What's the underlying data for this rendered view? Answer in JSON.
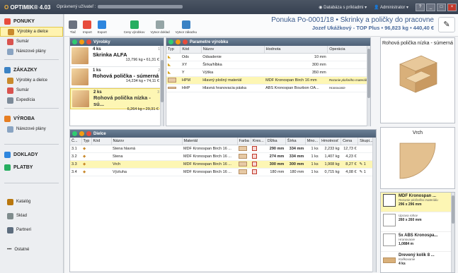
{
  "app": {
    "logo_prefix": "O",
    "logo_name": "OPTIMIK® 4.03",
    "user_label": "Oprávnený užívateľ :",
    "db_label": "Databáza s príkladmi",
    "admin_label": "Administrator",
    "help_label": "?"
  },
  "sidebar": {
    "sections": [
      {
        "title": "PONUKY",
        "items": [
          "Výrobky a dielce",
          "Sumár",
          "Nárezové plány"
        ]
      },
      {
        "title": "ZÁKAZKY",
        "items": [
          "Výrobky a dielce",
          "Sumár",
          "Expedícia"
        ]
      },
      {
        "title": "VÝROBA",
        "items": [
          "Nárezové plány"
        ]
      },
      {
        "title": "DOKLADY",
        "items": []
      },
      {
        "title": "PLATBY",
        "items": []
      }
    ],
    "bottom": [
      "Katalóg",
      "Sklad",
      "Partneri",
      "Ostatné"
    ]
  },
  "toolbar": {
    "buttons": [
      "Tlač",
      "Import",
      "Export",
      "Ceny výrobkov",
      "Vytvor doklad",
      "Vytvor zákazku"
    ]
  },
  "doc": {
    "title": "Ponuka Po-0001/18  •  Skrinky a poličky do pracovne",
    "subtitle": "Jozef Ukážkový - TOP Plus  •  96,823 kg  •  440,40 €"
  },
  "products": {
    "header": "Výrobky",
    "items": [
      {
        "num": "1",
        "qty": "4 ks",
        "name": "Skrinka ALFA",
        "price": "13,796 kg • 61,31 €"
      },
      {
        "num": "2",
        "qty": "1 ks",
        "name": "Rohová polička - súmerná",
        "price": "14,234 kg • 74,11 €"
      },
      {
        "num": "3",
        "qty": "2 ks",
        "name": "Rohová polička nízka - sú...",
        "price": "6,264 kg • 29,31 €"
      }
    ]
  },
  "params": {
    "header": "Parametre výrobku",
    "columns": [
      "Typ",
      "Kód",
      "Názov",
      "Hodnota",
      "Operácia"
    ],
    "rows": [
      {
        "code": "Ods",
        "name": "Odsadenie",
        "value": "10 mm",
        "op": ""
      },
      {
        "code": "XY",
        "name": "Šírka/hĺbka",
        "value": "300 mm",
        "op": ""
      },
      {
        "code": "Y",
        "name": "Výška",
        "value": "350 mm",
        "op": ""
      },
      {
        "code": "HPM",
        "name": "Hlavný plošný materiál",
        "value": "MDF Kronospan Birch 16 mm",
        "op": "Rezanie plošného materiálu"
      },
      {
        "code": "HHP",
        "name": "Hlavná hranovacia páska",
        "value": "ABS Kronospan Bourbon OA...",
        "op": "Hranovanie"
      }
    ]
  },
  "parts": {
    "header": "Dielce",
    "columns": [
      "Č...",
      "Typ",
      "Kód",
      "Názov",
      "Materiál",
      "Farba",
      "Kres...",
      "Dĺžka",
      "Šírka",
      "Mno...",
      "Hmotnosť",
      "Cena",
      "Skupi..."
    ],
    "rows": [
      {
        "no": "3.1",
        "name": "Stena hlavná",
        "mat": "MDF Kronospan Birch 16 ...",
        "len": "290 mm",
        "wid": "334 mm",
        "qty": "1 ks",
        "weight": "2,233 kg",
        "price": "12,73 €",
        "group": ""
      },
      {
        "no": "3.2",
        "name": "Stena",
        "mat": "MDF Kronospan Birch 16 ...",
        "len": "274 mm",
        "wid": "334 mm",
        "qty": "1 ks",
        "weight": "1,407 kg",
        "price": "4,23 €",
        "group": ""
      },
      {
        "no": "3.3",
        "name": "Vrch",
        "mat": "MDF Kronospan Birch 16 ...",
        "len": "300 mm",
        "wid": "300 mm",
        "qty": "1 ks",
        "weight": "1,908 kg",
        "price": "8,27 €",
        "group": "1"
      },
      {
        "no": "3.4",
        "name": "Výztuha",
        "mat": "MDF Kronospan Birch 16 ...",
        "len": "180 mm",
        "wid": "180 mm",
        "qty": "1 ks",
        "weight": "0,715 kg",
        "price": "4,08 €",
        "group": "1"
      }
    ]
  },
  "preview": {
    "product_title": "Rohová polička nízka - súmerná",
    "part_title": "Vrch"
  },
  "materials": [
    {
      "name": "MDF Kronospan ...",
      "op": "Rezanie plošného materiálu",
      "dim": "296 x 296 mm"
    },
    {
      "name": "",
      "op": "Úprava rohov",
      "dim": "260 x 260 mm"
    },
    {
      "name": "5x ABS Kronospa...",
      "op": "Hranovanie",
      "dim": "1,0884 m"
    },
    {
      "name": "Drevený kolík 8 ...",
      "op": "Kolíkovanie",
      "dim": "4 ks"
    }
  ]
}
